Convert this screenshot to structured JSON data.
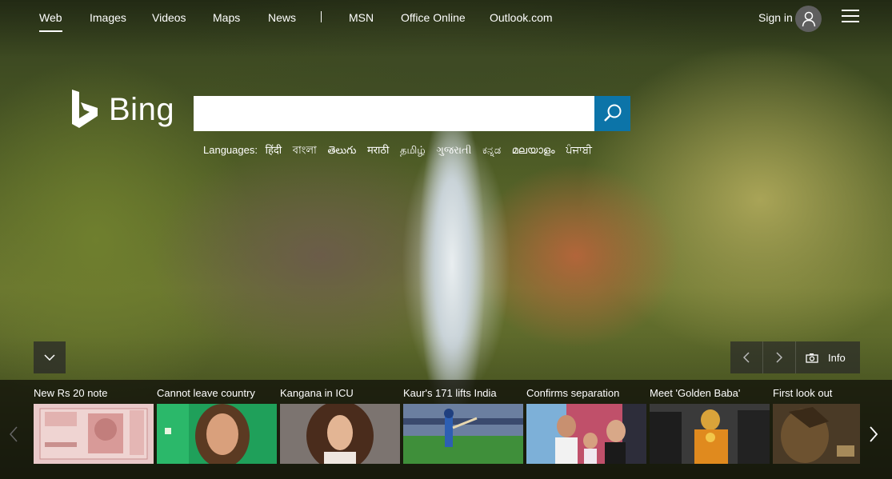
{
  "nav": {
    "items": [
      "Web",
      "Images",
      "Videos",
      "Maps",
      "News",
      "MSN",
      "Office Online",
      "Outlook.com"
    ],
    "signin": "Sign in"
  },
  "logo": {
    "text": "Bing"
  },
  "search": {
    "value": "",
    "placeholder": ""
  },
  "languages": {
    "label": "Languages:",
    "items": [
      "हिंदी",
      "বাংলা",
      "తెలుగు",
      "मराठी",
      "தமிழ்",
      "ગુજરાતી",
      "ಕನ್ನಡ",
      "മലയാളം",
      "ਪੰਜਾਬੀ"
    ]
  },
  "controls": {
    "info_label": "Info"
  },
  "news": [
    {
      "title": "New Rs 20 note",
      "thumb": "banknote"
    },
    {
      "title": "Cannot leave country",
      "thumb": "actress-portrait"
    },
    {
      "title": "Kangana in ICU",
      "thumb": "curly-hair-portrait"
    },
    {
      "title": "Kaur's 171 lifts India",
      "thumb": "cricket-batter"
    },
    {
      "title": "Confirms separation",
      "thumb": "family-photo"
    },
    {
      "title": "Meet 'Golden Baba'",
      "thumb": "golden-baba-crowd"
    },
    {
      "title": "First look out",
      "thumb": "warrior-poster"
    }
  ],
  "colors": {
    "search_button": "#0c74a8",
    "carousel_bg": "#12120a"
  }
}
